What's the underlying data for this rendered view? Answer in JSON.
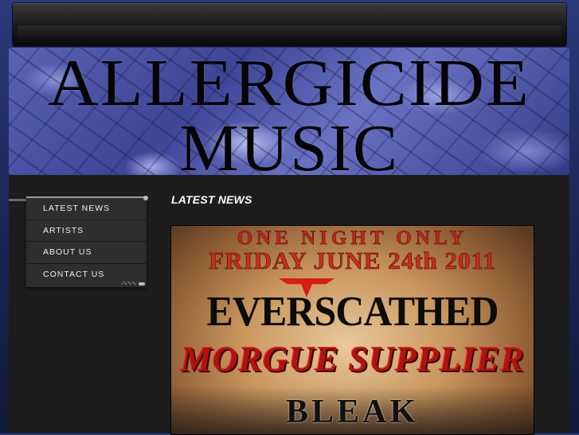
{
  "site": {
    "banner_line1": "ALLERGICIDE",
    "banner_line2": "MUSIC"
  },
  "nav": {
    "items": [
      {
        "label": "LATEST NEWS"
      },
      {
        "label": "ARTISTS"
      },
      {
        "label": "ABOUT US"
      },
      {
        "label": "CONTACT US"
      }
    ]
  },
  "main": {
    "section_title": "LATEST NEWS",
    "poster": {
      "headline1": "ONE NIGHT ONLY",
      "headline2": "FRIDAY JUNE 24th 2011",
      "band1": "EVERSCATHED",
      "band2": "MORGUE SUPPLIER",
      "band3": "BLEAK"
    }
  },
  "colors": {
    "background_blue": "#1a2352",
    "content_dark": "#1d1d1d",
    "nav_dark": "#2e2e2e",
    "poster_red": "#c8231a"
  }
}
